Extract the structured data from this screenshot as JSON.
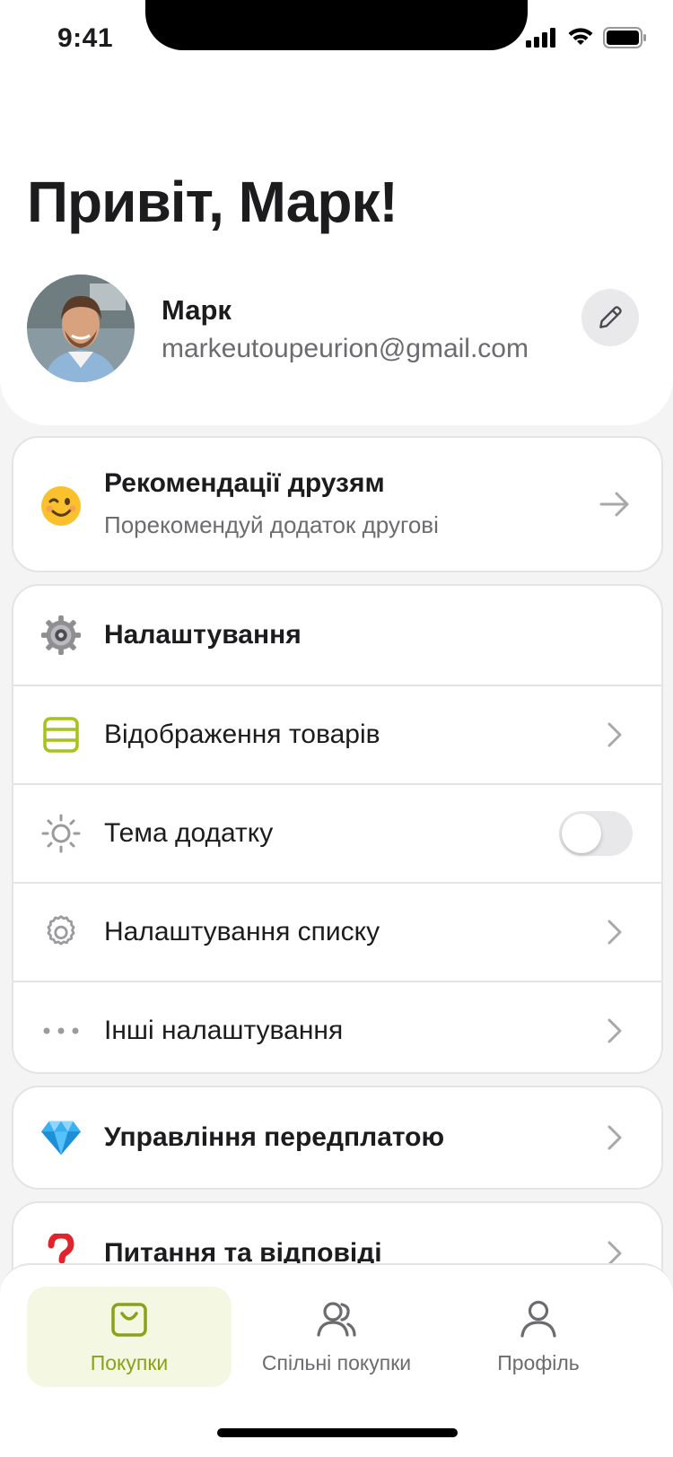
{
  "status_bar": {
    "time": "9:41"
  },
  "greeting": "Привіт, Марк!",
  "profile": {
    "name": "Марк",
    "email": "markeutoupeurion@gmail.com"
  },
  "recommend": {
    "title": "Рекомендації друзям",
    "subtitle": "Порекомендуй додаток другові",
    "icon": "winking-face-emoji"
  },
  "settings": {
    "header": "Налаштування",
    "items": [
      {
        "label": "Відображення товарів",
        "icon": "layout-rows-icon",
        "accent": "#a6c21c"
      },
      {
        "label": "Тема додатку",
        "icon": "sun-icon",
        "toggle_on": false
      },
      {
        "label": "Налаштування списку",
        "icon": "gear-icon"
      },
      {
        "label": "Інші налаштування",
        "icon": "more-dots-icon"
      }
    ]
  },
  "subscription": {
    "label": "Управління передплатою",
    "icon": "gem-emoji"
  },
  "faq": {
    "label": "Питання та відповіді",
    "icon": "question-mark-emoji"
  },
  "tabs": [
    {
      "label": "Покупки",
      "icon": "shopping-bag-icon",
      "active": true
    },
    {
      "label": "Спільні покупки",
      "icon": "users-icon",
      "active": false
    },
    {
      "label": "Профіль",
      "icon": "user-icon",
      "active": false
    }
  ],
  "colors": {
    "accent": "#a6c21c",
    "accent_bg": "#f4f7e1",
    "background": "#f4f4f5"
  }
}
